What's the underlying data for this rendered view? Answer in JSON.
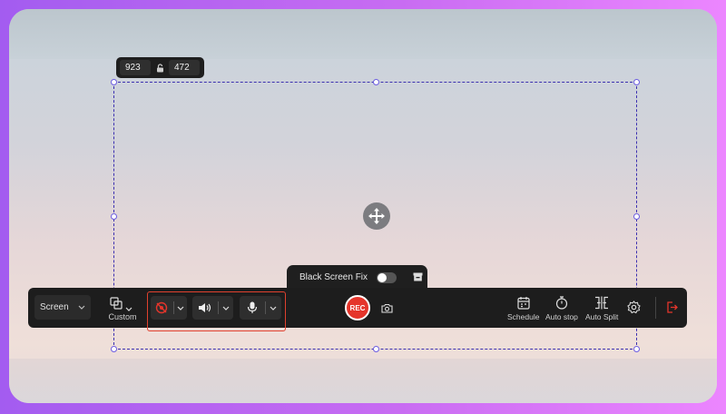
{
  "dimensions": {
    "width": "923",
    "height": "472"
  },
  "black_screen_fix": {
    "label": "Black Screen Fix",
    "enabled": false
  },
  "toolbar": {
    "source": "Screen",
    "area_mode": "Custom",
    "rec_label": "REC",
    "tools": [
      {
        "label": "Schedule",
        "icon": "calendar-icon"
      },
      {
        "label": "Auto stop",
        "icon": "timer-icon"
      },
      {
        "label": "Auto Split",
        "icon": "split-icon"
      }
    ]
  },
  "colors": {
    "accent": "#e5352b",
    "selection": "#3b2fb0",
    "toolbar_bg": "#1d1d1d"
  }
}
